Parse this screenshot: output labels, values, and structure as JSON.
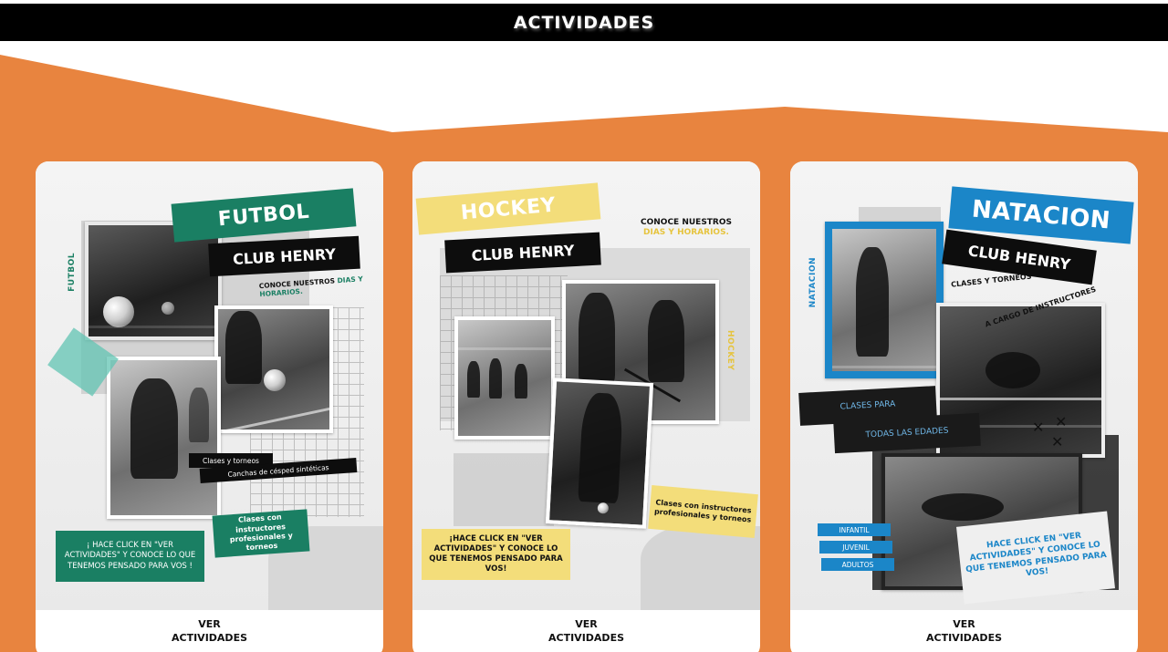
{
  "header": {
    "title": "ACTIVIDADES"
  },
  "colors": {
    "accent": "#E8843F",
    "futbol": "#1A7F63",
    "hockey": "#F3DD7A",
    "natacion": "#1B86C8",
    "header_bg": "#000000"
  },
  "cards": [
    {
      "sport": "FUTBOL",
      "title": "FUTBOL",
      "club": "CLUB HENRY",
      "vertical_label": "FUTBOL",
      "conoce_a": "CONOCE NUESTROS ",
      "conoce_b": "DIAS Y HORARIOS.",
      "tag_1": "Clases y torneos",
      "tag_2": "Canchas de césped sintéticas",
      "instructores": "Clases con instructores profesionales y torneos",
      "cta": "¡ HACE CLICK EN \"VER ACTIVIDADES\" Y CONOCE LO QUE TENEMOS PENSADO PARA VOS !",
      "button_line1": "VER",
      "button_line2": "ACTIVIDADES"
    },
    {
      "sport": "HOCKEY",
      "title": "HOCKEY",
      "club": "CLUB HENRY",
      "vertical_label": "HOCKEY",
      "conoce_a": "CONOCE NUESTROS",
      "conoce_b": "DIAS Y HORARIOS.",
      "instructores": "Clases con instructores profesionales y torneos",
      "cta": "¡HACE CLICK EN \"VER ACTIVIDADES\" Y CONOCE LO QUE TENEMOS PENSADO PARA VOS!",
      "button_line1": "VER",
      "button_line2": "ACTIVIDADES"
    },
    {
      "sport": "NATACION",
      "title": "NATACION",
      "club": "CLUB HENRY",
      "vertical_label": "NATACION",
      "clases_torneos": "CLASES Y TORNEOS",
      "a_cargo": "A CARGO DE INSTRUCTORES",
      "clases_para": "CLASES PARA",
      "todas_edades": "TODAS LAS EDADES",
      "levels": [
        "INFANTIL",
        "JUVENIL",
        "ADULTOS"
      ],
      "cta_a": "HACE CLICK ",
      "cta_b": "EN",
      "cta_c": " \"VER ACTIVIDADES\" Y CONOCE LO QUE TENEMOS PENSADO PARA VOS!",
      "button_line1": "VER",
      "button_line2": "ACTIVIDADES"
    }
  ]
}
